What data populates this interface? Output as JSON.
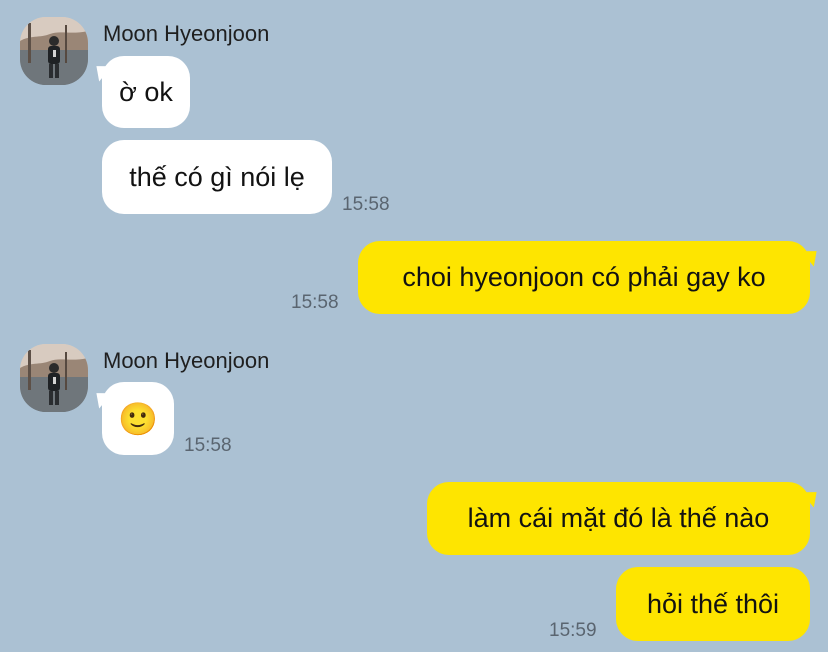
{
  "conversation": {
    "contact_name": "Moon Hyeonjoon",
    "colors": {
      "background": "#abc1d3",
      "incoming_bubble": "#ffffff",
      "outgoing_bubble": "#fee500",
      "time_text": "#5a6570"
    },
    "messages": [
      {
        "id": "m1",
        "direction": "incoming",
        "sender": "Moon Hyeonjoon",
        "text": "ờ ok",
        "time": ""
      },
      {
        "id": "m2",
        "direction": "incoming",
        "sender": "",
        "text": "thế có gì nói lẹ",
        "time": "15:58"
      },
      {
        "id": "m3",
        "direction": "outgoing",
        "text": "choi hyeonjoon có phải gay ko",
        "time": "15:58"
      },
      {
        "id": "m4",
        "direction": "incoming",
        "sender": "Moon Hyeonjoon",
        "text": "🙂",
        "time": "15:58"
      },
      {
        "id": "m5",
        "direction": "outgoing",
        "text": "làm cái mặt đó là thế nào",
        "time": ""
      },
      {
        "id": "m6",
        "direction": "outgoing",
        "text": "hỏi thế thôi",
        "time": "15:59"
      }
    ]
  }
}
